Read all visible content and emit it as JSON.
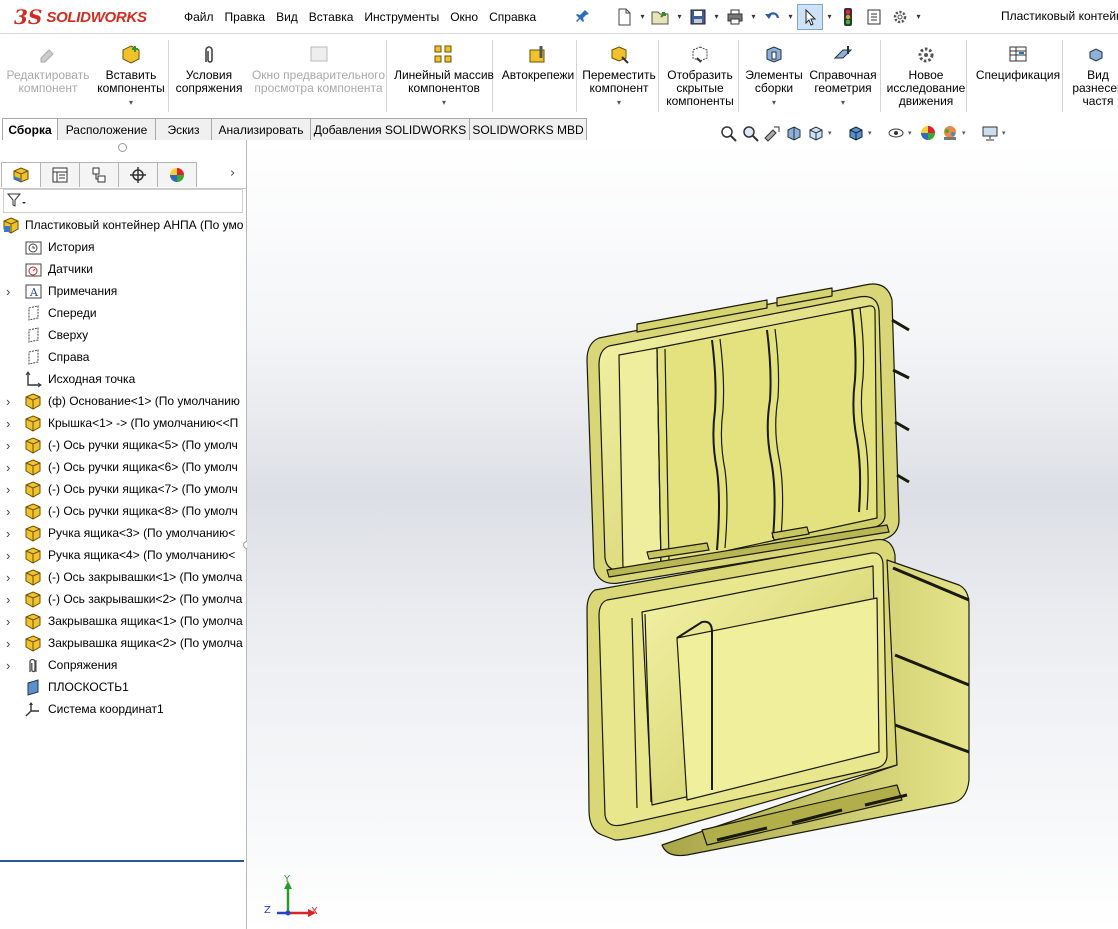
{
  "app": {
    "logo_ds": "3S",
    "logo_text": "SOLIDWORKS"
  },
  "menu": [
    "Файл",
    "Правка",
    "Вид",
    "Вставка",
    "Инструменты",
    "Окно",
    "Справка"
  ],
  "document_title": "Пластиковый контейн",
  "quick_access": [
    "new-document-icon",
    "open-icon",
    "save-icon",
    "print-icon",
    "undo-icon",
    "select-arrow-icon",
    "rebuild-traffic-light-icon",
    "file-properties-icon",
    "options-gear-icon"
  ],
  "ribbon": [
    {
      "label_lines": [
        "Редактировать",
        "компонент"
      ],
      "enabled": false,
      "icon": "edit-component-icon"
    },
    {
      "label_lines": [
        "Вставить",
        "компоненты"
      ],
      "enabled": true,
      "dropdown": true,
      "icon": "insert-components-icon"
    },
    {
      "label_lines": [
        "Условия",
        "сопряжения"
      ],
      "enabled": true,
      "icon": "mate-paperclip-icon"
    },
    {
      "label_lines": [
        "Окно предварительного",
        "просмотра компонента"
      ],
      "enabled": false,
      "icon": "component-preview-icon"
    },
    {
      "label_lines": [
        "Линейный массив",
        "компонентов"
      ],
      "enabled": true,
      "dropdown": true,
      "icon": "linear-pattern-icon"
    },
    {
      "label_lines": [
        "Автокрепежи"
      ],
      "enabled": true,
      "icon": "smart-fasteners-icon"
    },
    {
      "label_lines": [
        "Переместить",
        "компонент"
      ],
      "enabled": true,
      "dropdown": true,
      "icon": "move-component-icon"
    },
    {
      "label_lines": [
        "Отобразить",
        "скрытые",
        "компоненты"
      ],
      "enabled": true,
      "icon": "show-hidden-icon"
    },
    {
      "label_lines": [
        "Элементы",
        "сборки"
      ],
      "enabled": true,
      "dropdown": true,
      "icon": "assembly-features-icon"
    },
    {
      "label_lines": [
        "Справочная",
        "геометрия"
      ],
      "enabled": true,
      "dropdown": true,
      "icon": "reference-geometry-icon"
    },
    {
      "label_lines": [
        "Новое",
        "исследование",
        "движения"
      ],
      "enabled": true,
      "icon": "motion-study-icon"
    },
    {
      "label_lines": [
        "Спецификация"
      ],
      "enabled": true,
      "icon": "bom-icon"
    },
    {
      "label_lines": [
        "Вид",
        "разнесен",
        "частя"
      ],
      "enabled": true,
      "icon": "exploded-view-icon"
    }
  ],
  "tabs": [
    {
      "label": "Сборка",
      "active": true
    },
    {
      "label": "Расположение",
      "active": false
    },
    {
      "label": "Эскиз",
      "active": false
    },
    {
      "label": "Анализировать",
      "active": false
    },
    {
      "label": "Добавления SOLIDWORKS",
      "active": false
    },
    {
      "label": "SOLIDWORKS MBD",
      "active": false
    }
  ],
  "heads_up": [
    "zoom-to-fit-icon",
    "zoom-to-area-icon",
    "previous-view-icon",
    "section-view-icon",
    "view-orientation-icon",
    "display-style-icon",
    "hide-show-items-icon",
    "edit-appearance-icon",
    "apply-scene-icon",
    "view-settings-icon"
  ],
  "pane_tabs": [
    "featuremanager-icon",
    "propertymanager-icon",
    "configurationmanager-icon",
    "dimxpertmanager-icon",
    "displaymanager-icon"
  ],
  "tree": [
    {
      "label": "Пластиковый контейнер АНПА  (По умо",
      "icon": "assembly-icon",
      "level": 0,
      "expandable": false
    },
    {
      "label": "История",
      "icon": "history-folder-icon",
      "level": 1,
      "expandable": false
    },
    {
      "label": "Датчики",
      "icon": "sensors-folder-icon",
      "level": 1,
      "expandable": false
    },
    {
      "label": "Примечания",
      "icon": "annotations-icon",
      "level": 1,
      "expandable": true
    },
    {
      "label": "Спереди",
      "icon": "plane-icon",
      "level": 1,
      "expandable": false
    },
    {
      "label": "Сверху",
      "icon": "plane-icon",
      "level": 1,
      "expandable": false
    },
    {
      "label": "Справа",
      "icon": "plane-icon",
      "level": 1,
      "expandable": false
    },
    {
      "label": "Исходная точка",
      "icon": "origin-icon",
      "level": 1,
      "expandable": false
    },
    {
      "label": "(ф) Основание<1> (По умолчанию",
      "icon": "part-icon",
      "level": 1,
      "expandable": true
    },
    {
      "label": "Крышка<1> -> (По умолчанию<<П",
      "icon": "part-icon",
      "level": 1,
      "expandable": true
    },
    {
      "label": "(-) Ось ручки ящика<5> (По умолч",
      "icon": "part-icon",
      "level": 1,
      "expandable": true
    },
    {
      "label": "(-) Ось ручки ящика<6> (По умолч",
      "icon": "part-icon",
      "level": 1,
      "expandable": true
    },
    {
      "label": "(-) Ось ручки ящика<7> (По умолч",
      "icon": "part-icon",
      "level": 1,
      "expandable": true
    },
    {
      "label": "(-) Ось ручки ящика<8> (По умолч",
      "icon": "part-icon",
      "level": 1,
      "expandable": true
    },
    {
      "label": "Ручка ящика<3> (По умолчанию<",
      "icon": "part-icon",
      "level": 1,
      "expandable": true
    },
    {
      "label": "Ручка ящика<4> (По умолчанию<",
      "icon": "part-icon",
      "level": 1,
      "expandable": true
    },
    {
      "label": "(-) Ось закрывашки<1> (По умолча",
      "icon": "part-icon",
      "level": 1,
      "expandable": true
    },
    {
      "label": "(-) Ось закрывашки<2> (По умолча",
      "icon": "part-icon",
      "level": 1,
      "expandable": true
    },
    {
      "label": "Закрывашка ящика<1> (По умолча",
      "icon": "part-icon",
      "level": 1,
      "expandable": true
    },
    {
      "label": "Закрывашка ящика<2> (По умолча",
      "icon": "part-icon",
      "level": 1,
      "expandable": true
    },
    {
      "label": "Сопряжения",
      "icon": "mates-icon",
      "level": 1,
      "expandable": true
    },
    {
      "label": "ПЛОСКОСТЬ1",
      "icon": "plane-solid-icon",
      "level": 1,
      "expandable": false
    },
    {
      "label": "Система координат1",
      "icon": "coordinate-system-icon",
      "level": 1,
      "expandable": false
    }
  ],
  "triad": {
    "x": "X",
    "y": "Y",
    "z": "Z"
  },
  "colors": {
    "model_yellow": "#e8e68a",
    "model_edge": "#1a1a0a",
    "accent_red": "#d52b1e",
    "tree_selection_line": "#2b579a"
  }
}
